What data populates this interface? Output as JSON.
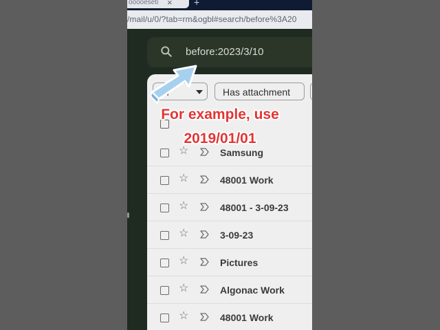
{
  "browser": {
    "tab_title": "ooooeseti",
    "tab_close": "×",
    "new_tab": "+",
    "url": "/mail/u/0/?tab=rm&ogbl#search/before%3A20"
  },
  "search": {
    "query": "before:2023/3/10"
  },
  "filters": {
    "first_chip_label": "Fr",
    "attachment_chip_label": "Has attachment"
  },
  "rows": [
    {
      "subject": "Samsung"
    },
    {
      "subject": "48001 Work"
    },
    {
      "subject": "48001 - 3-09-23"
    },
    {
      "subject": "3-09-23"
    },
    {
      "subject": "Pictures"
    },
    {
      "subject": "Algonac Work"
    },
    {
      "subject": "48001 Work"
    }
  ],
  "overlay": {
    "line1": "For example, use",
    "line2": "2019/01/01"
  },
  "colors": {
    "overlay_text": "#e23535",
    "arrow_fill": "#a7d0ef",
    "gmail_dark": "#1f2a21"
  }
}
